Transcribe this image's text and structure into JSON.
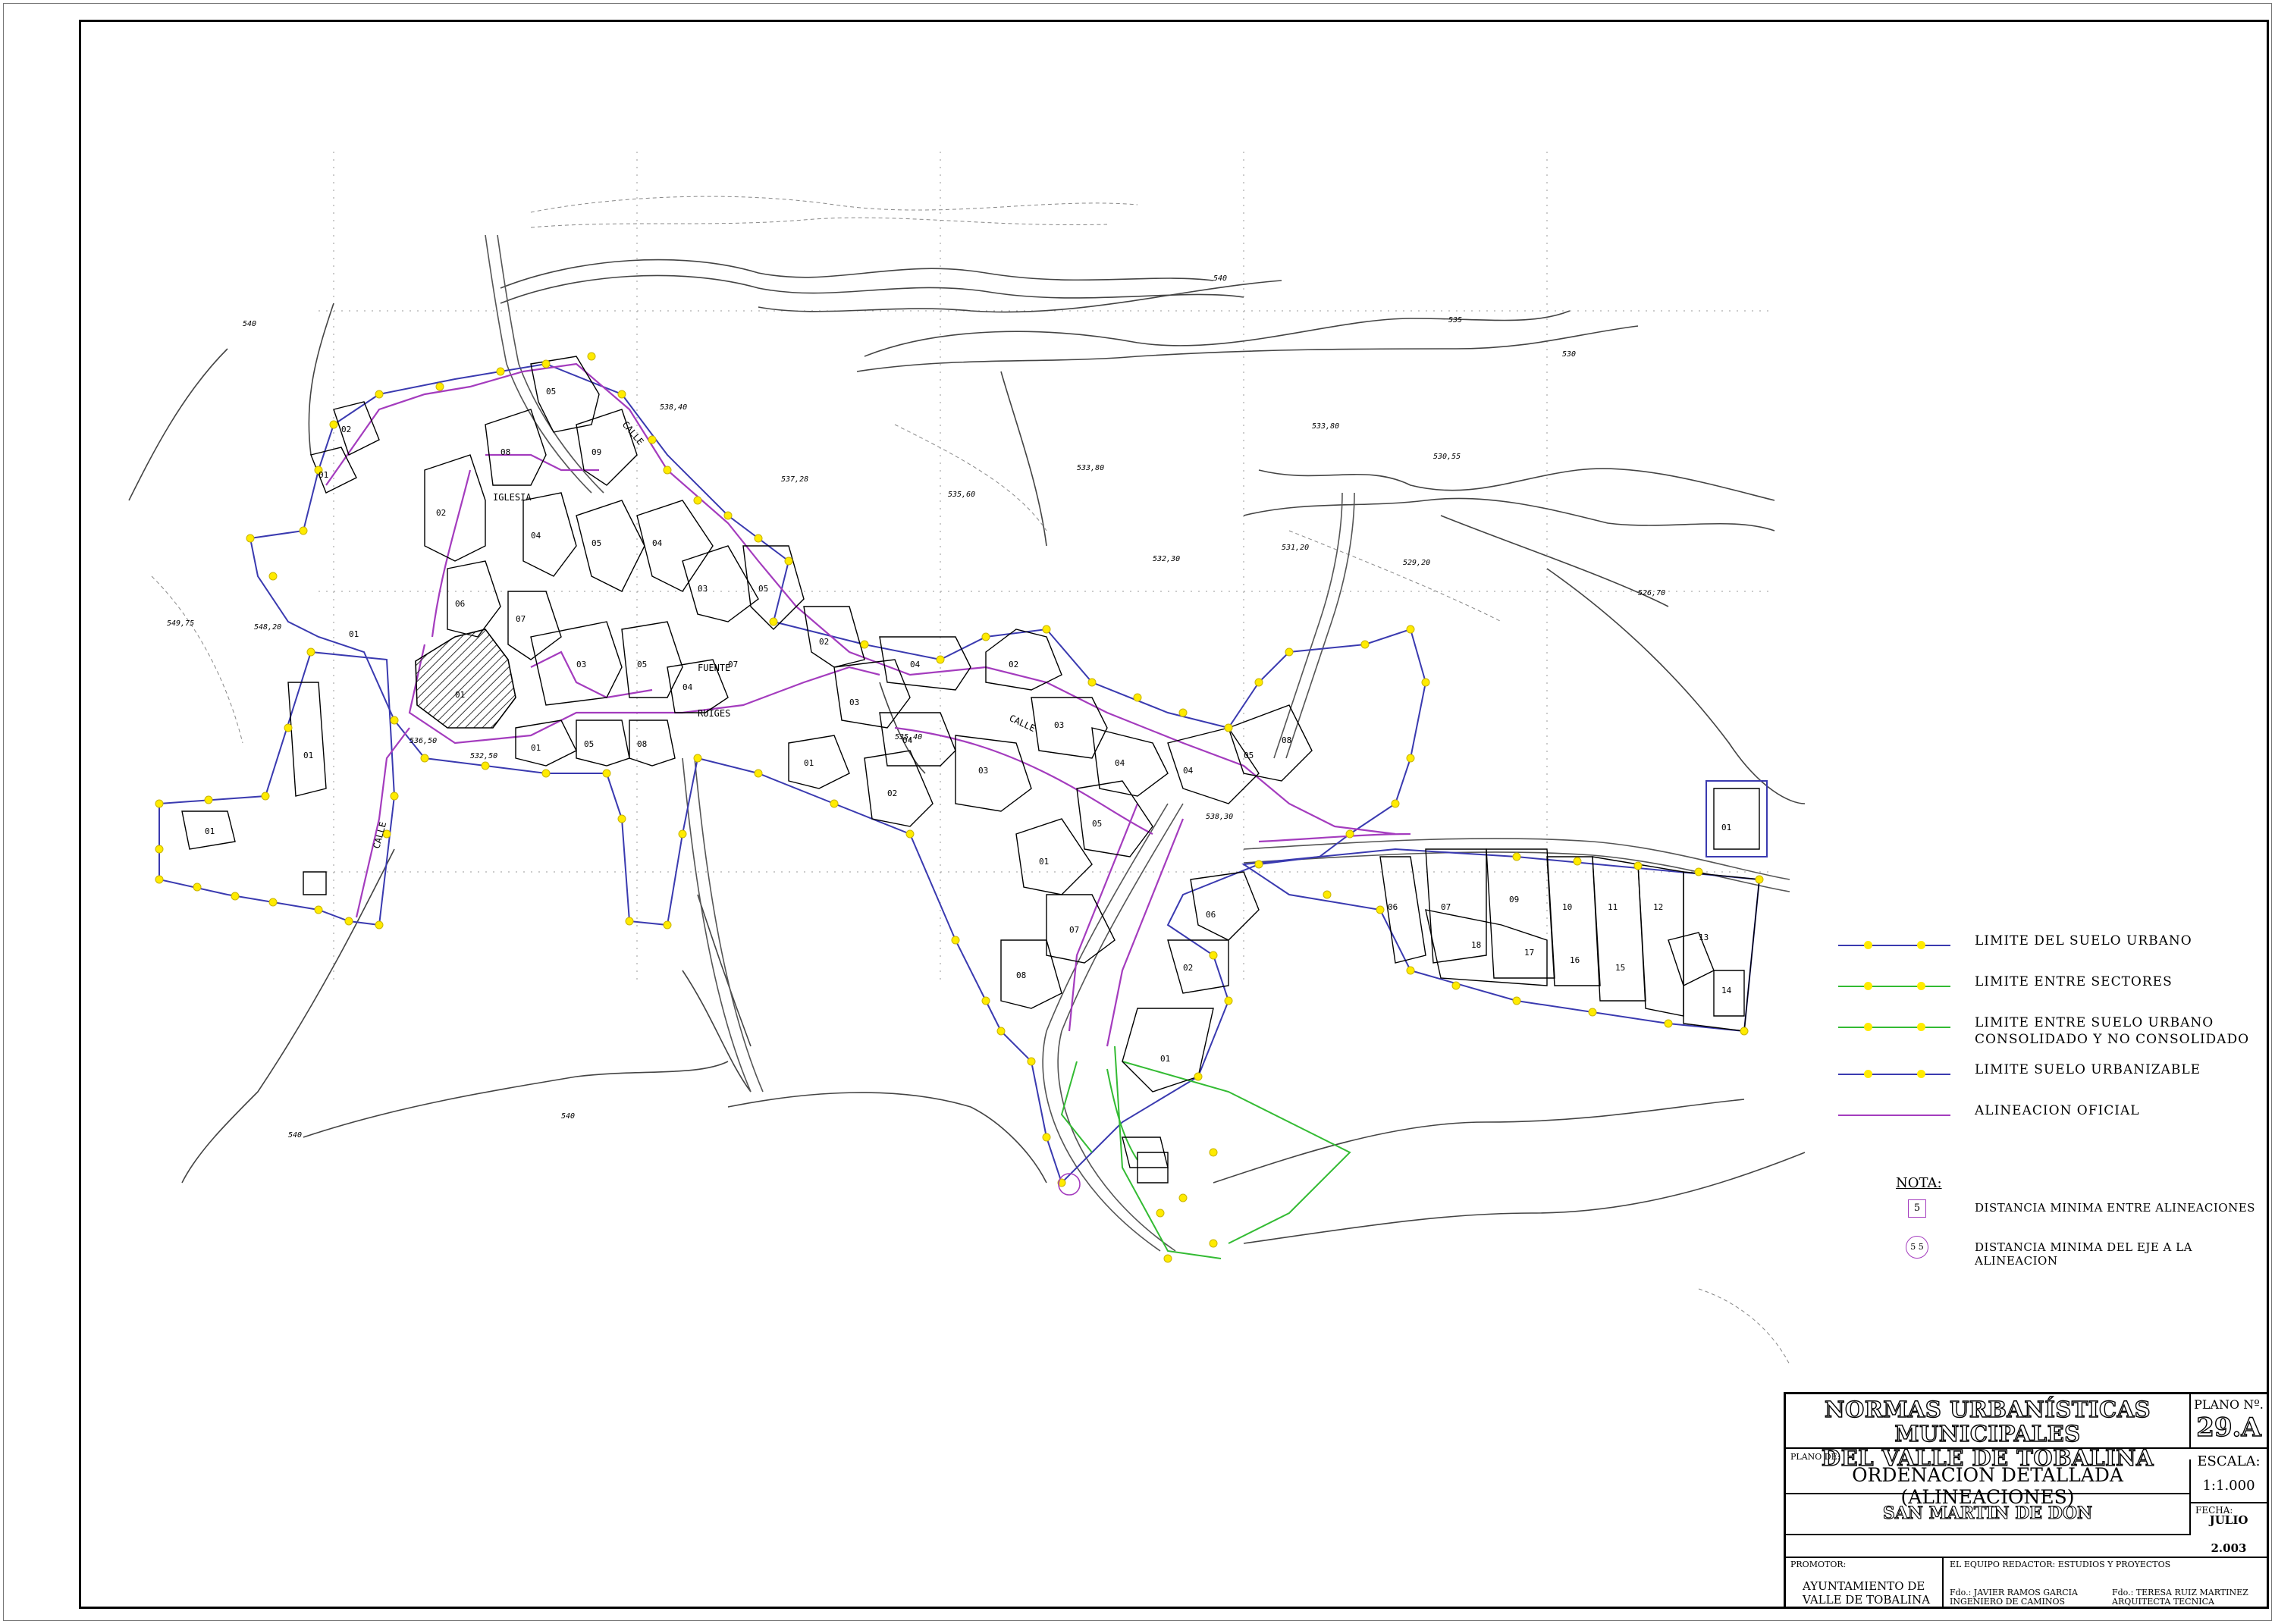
{
  "legend": {
    "items": [
      {
        "label": "LIMITE DEL SUELO URBANO",
        "line_color": "#3a3ab0",
        "dot_color": "#ffeb00"
      },
      {
        "label": "LIMITE ENTRE SECTORES",
        "line_color": "#33bb33",
        "dot_color": "#ffeb00"
      },
      {
        "label": "LIMITE ENTRE SUELO URBANO\nCONSOLIDADO Y NO CONSOLIDADO",
        "line_color": "#33bb33",
        "dot_color": "#ffeb00"
      },
      {
        "label": "LIMITE SUELO URBANIZABLE",
        "line_color": "#3a3ab0",
        "dot_color": "#ffeb00"
      },
      {
        "label": "ALINEACION OFICIAL",
        "line_color": "#a43cbe",
        "dot_color": ""
      }
    ],
    "nota_title": "NOTA:",
    "notes": [
      {
        "symbol": "5",
        "label": "DISTANCIA MINIMA ENTRE ALINEACIONES"
      },
      {
        "symbol": "5 5",
        "label": "DISTANCIA MINIMA DEL EJE A LA ALINEACION"
      }
    ]
  },
  "title_block": {
    "title_line1": "NORMAS URBANÍSTICAS MUNICIPALES",
    "title_line2": "DEL VALLE DE TOBALINA",
    "plano_label": "PLANO Nº.",
    "plano_number": "29.A",
    "plano_de_label": "PLANO DE:",
    "plano_de": "ORDENACION DETALLADA (ALINEACIONES)",
    "escala_label": "ESCALA:",
    "escala": "1:1.000",
    "place": "SAN MARTIN DE DON",
    "fecha_label": "FECHA:",
    "fecha_month": "JULIO",
    "fecha_year": "2.003",
    "promotor_label": "PROMOTOR:",
    "promotor": "AYUNTAMIENTO DE\nVALLE DE TOBALINA",
    "equipo": "EL EQUIPO REDACTOR: ESTUDIOS Y PROYECTOS",
    "firma1": "Fdo.: JAVIER RAMOS GARCIA\n          INGENIERO DE CAMINOS",
    "firma2": "Fdo.: TERESA RUIZ MARTINEZ\n          ARQUITECTA TECNICA"
  },
  "map": {
    "street_labels": [
      "IGLESIA",
      "FUENTE",
      "RUIGES",
      "CALLE",
      "CALLE",
      "CALLE"
    ],
    "elevation_labels": [
      "538,40",
      "537,28",
      "535,60",
      "533,80",
      "533,80",
      "532,30",
      "531,20",
      "529,20",
      "526,70",
      "530,55",
      "549,75",
      "548,20",
      "536,50",
      "532,50",
      "535,40",
      "538,30",
      "540",
      "535",
      "530",
      "540",
      "540",
      "540"
    ],
    "parcel_labels": [
      "01",
      "02",
      "03",
      "04",
      "05",
      "06",
      "07",
      "08",
      "09",
      "10",
      "11",
      "12",
      "13",
      "14",
      "15",
      "16",
      "17",
      "18"
    ],
    "colors": {
      "urban_limit": "#3a3ab0",
      "alignment": "#a43cbe",
      "sector_limit": "#33bb33",
      "marker": "#ffeb00",
      "hatched_church": "#555555"
    }
  }
}
